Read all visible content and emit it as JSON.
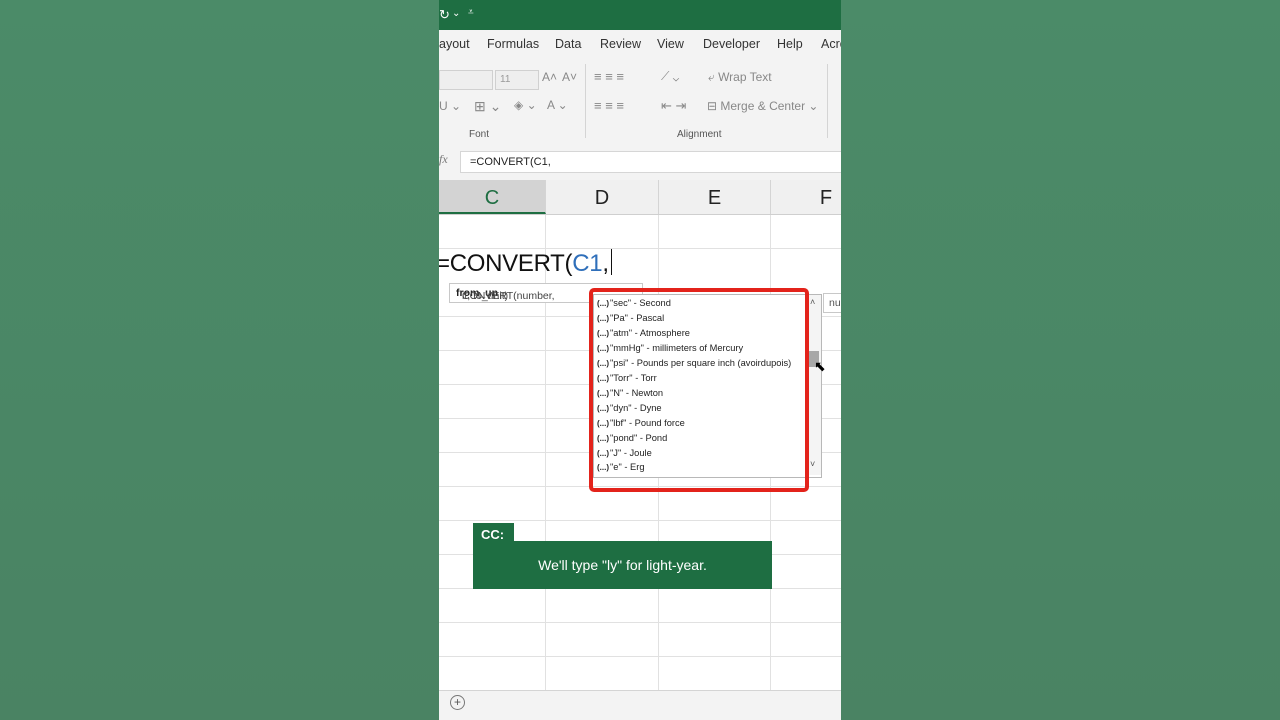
{
  "ribbon_tabs": [
    "ayout",
    "Formulas",
    "Data",
    "Review",
    "View",
    "Developer",
    "Help",
    "Acro"
  ],
  "ribbon": {
    "font_size": "11",
    "font_group_label": "Font",
    "alignment_group_label": "Alignment",
    "wrap_text": "Wrap Text",
    "merge_center": "Merge & Center"
  },
  "formula_bar": {
    "fx_label": "fx",
    "value": "=CONVERT(C1,"
  },
  "columns": [
    "C",
    "D",
    "E",
    "F"
  ],
  "cell_edit": {
    "prefix": "=CONVERT(",
    "ref": "C1",
    "suffix": ","
  },
  "tooltip": {
    "prefix": "CONVERT(number, ",
    "bold": "from_un",
    "rest": "it, to_unit)",
    "right_fragment": "nu"
  },
  "autocomplete": {
    "icon": "(...)",
    "items": [
      "\"sec\" - Second",
      "\"Pa\" - Pascal",
      "\"atm\" - Atmosphere",
      "\"mmHg\" - millimeters of Mercury",
      "\"psi\" - Pounds per square inch (avoirdupois)",
      "\"Torr\" - Torr",
      "\"N\" - Newton",
      "\"dyn\" - Dyne",
      "\"lbf\" - Pound force",
      "\"pond\" - Pond",
      "\"J\" - Joule",
      "\"e\" - Erg"
    ]
  },
  "caption": {
    "tag": "CC:",
    "text": "We'll type \"ly\" for light-year."
  },
  "colors": {
    "excel_green": "#1e6e42",
    "highlight_red": "#e3231b",
    "cell_ref_blue": "#2f6fba"
  }
}
